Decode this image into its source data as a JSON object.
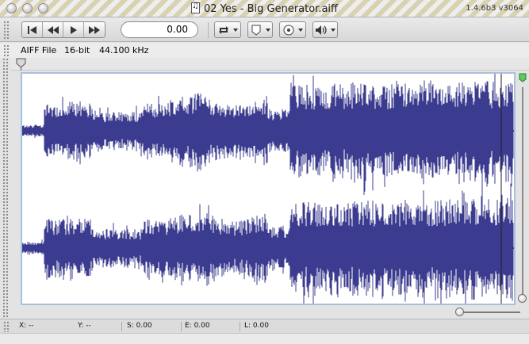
{
  "window": {
    "title": "02 Yes - Big Generator.aiff",
    "version": "1.4.6b3 v3064"
  },
  "toolbar": {
    "transport": [
      {
        "name": "skip-to-start-icon"
      },
      {
        "name": "rewind-icon"
      },
      {
        "name": "play-icon"
      },
      {
        "name": "fast-forward-icon"
      }
    ],
    "time_value": "0.00",
    "dropdowns": [
      {
        "name": "loop-icon"
      },
      {
        "name": "marker-icon"
      },
      {
        "name": "record-icon"
      },
      {
        "name": "volume-icon"
      }
    ]
  },
  "file_info": {
    "format": "AIFF File",
    "bit_depth": "16-bit",
    "sample_rate": "44.100 kHz"
  },
  "waveform": {
    "color": "#3b3b8f",
    "channels": 2
  },
  "status": {
    "x": "X: --",
    "y": "Y: --",
    "s": "S: 0.00",
    "e": "E: 0.00",
    "l": "L: 0.00"
  }
}
